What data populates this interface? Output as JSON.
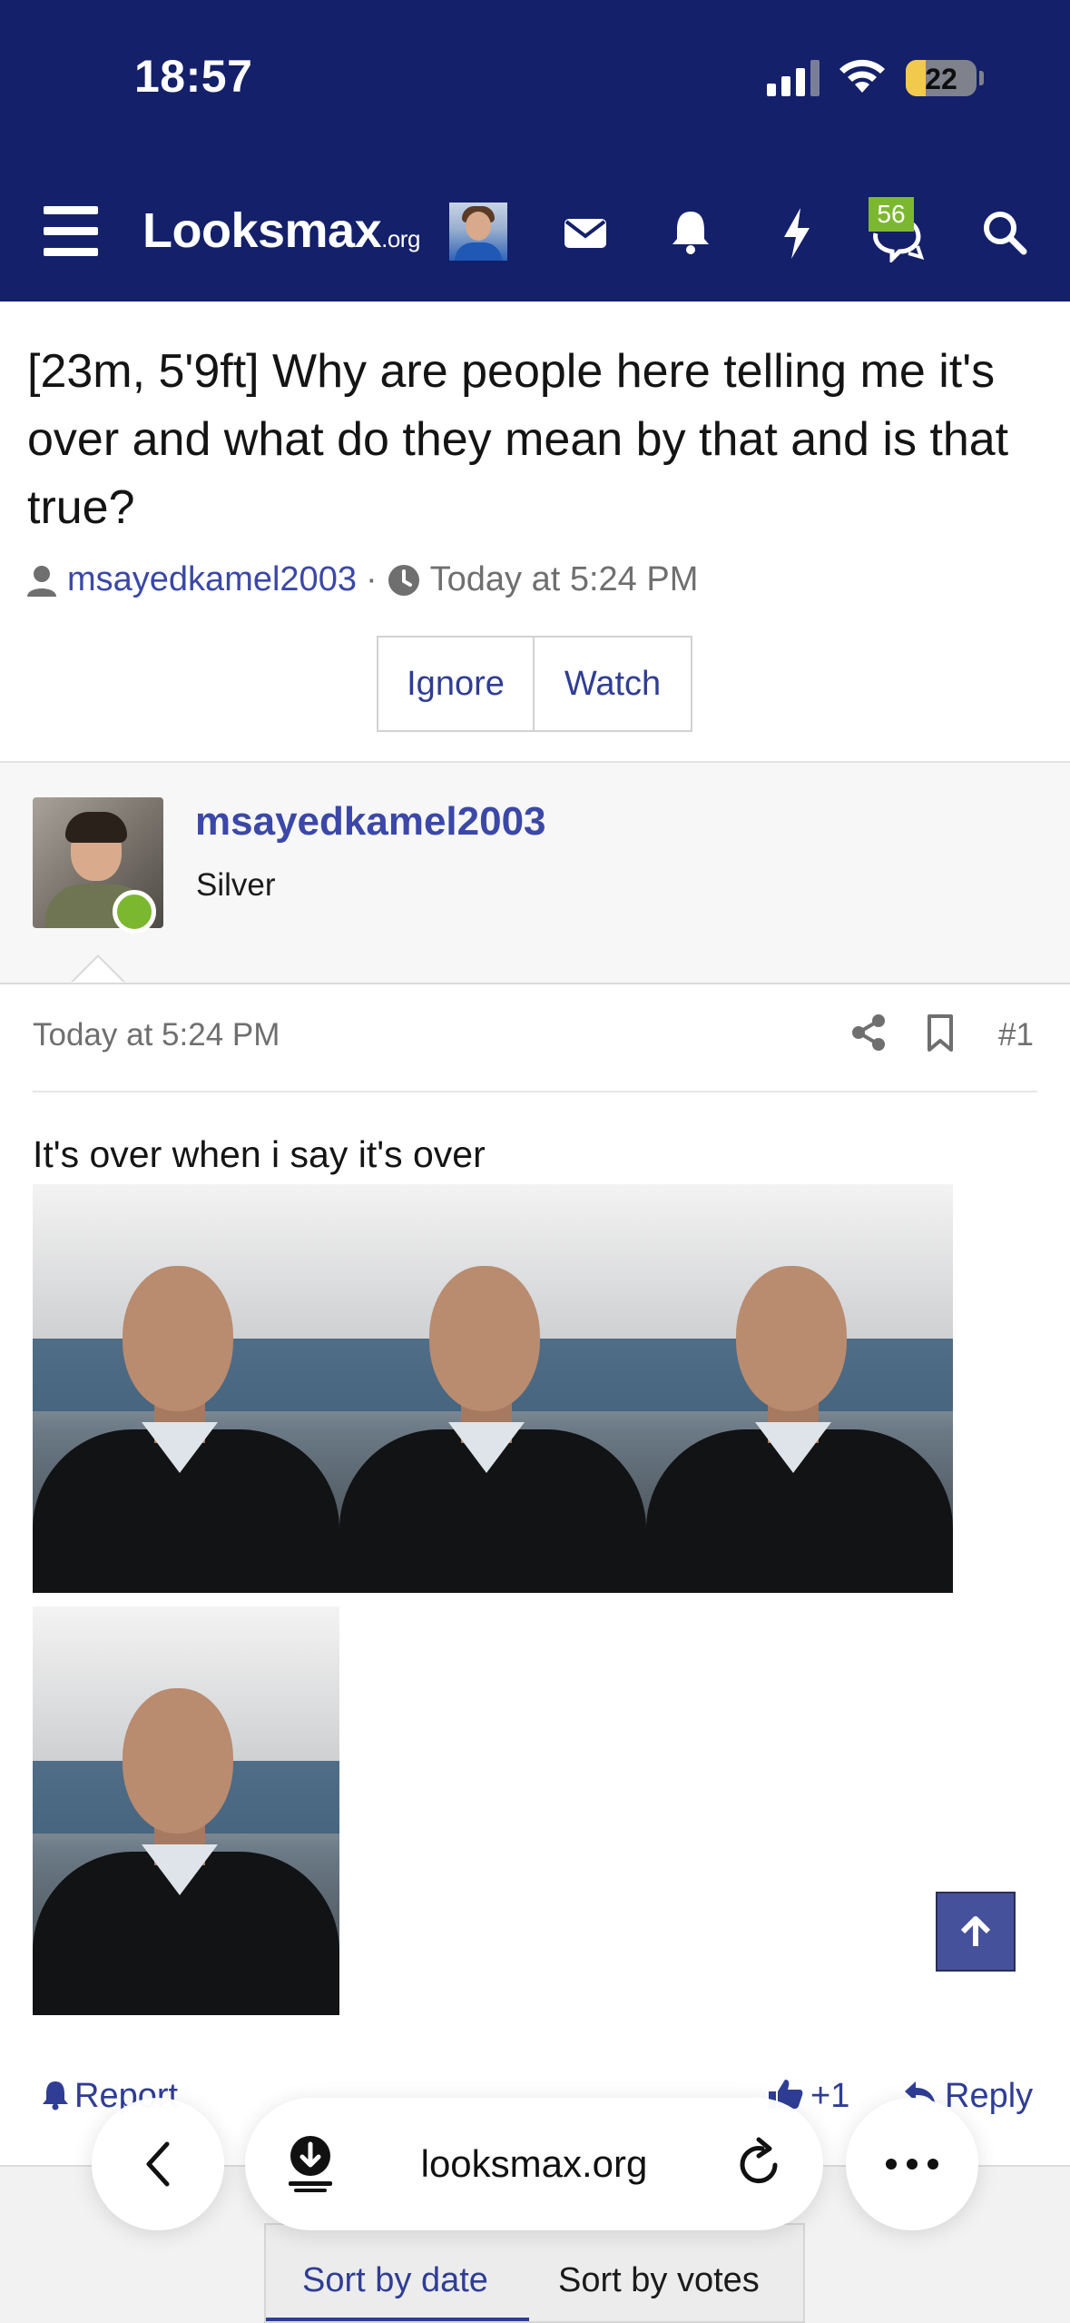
{
  "status_bar": {
    "time": "18:57",
    "battery": "22"
  },
  "header": {
    "logo_main": "Looksmax",
    "logo_suffix": ".org",
    "conversations_badge": "56"
  },
  "thread": {
    "title": "[23m, 5'9ft] Why are people here telling me it's over and what do they mean by that and is that true?",
    "author": "msayedkamel2003",
    "separator": "·",
    "date": "Today at 5:24 PM",
    "ignore_label": "Ignore",
    "watch_label": "Watch"
  },
  "post": {
    "username": "msayedkamel2003",
    "user_title": "Silver",
    "date": "Today at 5:24 PM",
    "number": "#1",
    "body": "It's over when i say it's over",
    "report_label": "Report",
    "like_label": "+1",
    "reply_label": "Reply"
  },
  "sort": {
    "by_date": "Sort by date",
    "by_votes": "Sort by votes"
  },
  "browser": {
    "url": "looksmax.org"
  },
  "colors": {
    "header_bg": "#14206a",
    "link": "#3b48a8",
    "online": "#7cb82f",
    "scroll_top_bg": "#45519a"
  }
}
